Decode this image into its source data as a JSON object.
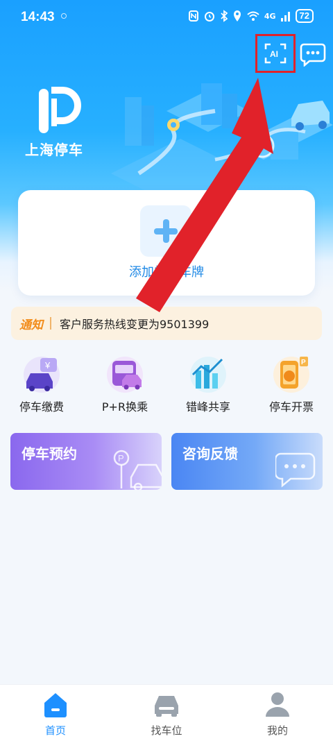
{
  "status_bar": {
    "time": "14:43",
    "network": "4G",
    "battery": "72"
  },
  "header": {
    "scan_icon": "ai-scan-icon",
    "chat_icon": "chat-bubble-icon"
  },
  "brand": {
    "logo_text": "上海停车"
  },
  "plate_card": {
    "add_label": "添加常用车牌"
  },
  "notice": {
    "tag": "通知",
    "text": "客户服务热线变更为9501399"
  },
  "services": [
    {
      "label": "停车缴费",
      "icon": "parking-payment-icon"
    },
    {
      "label": "P+R换乘",
      "icon": "bus-transfer-icon"
    },
    {
      "label": "错峰共享",
      "icon": "shared-parking-icon"
    },
    {
      "label": "停车开票",
      "icon": "parking-invoice-icon"
    }
  ],
  "cards": {
    "reservation": "停车预约",
    "feedback": "咨询反馈"
  },
  "tabbar": [
    {
      "label": "首页",
      "icon": "home-icon",
      "active": true
    },
    {
      "label": "找车位",
      "icon": "car-icon",
      "active": false
    },
    {
      "label": "我的",
      "icon": "user-icon",
      "active": false
    }
  ],
  "colors": {
    "primary": "#1e90ff",
    "annotation_red": "#e1222a",
    "notice_orange": "#f28c1b"
  }
}
